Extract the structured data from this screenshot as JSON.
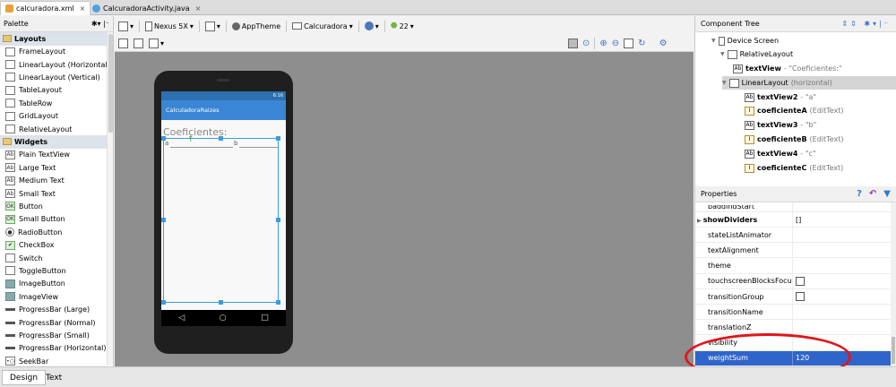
{
  "editor_tabs": [
    {
      "label": "calcuradora.xml",
      "close": "×",
      "icon": "xml-file-icon"
    },
    {
      "label": "CalcuradoraActivity.java",
      "close": "×",
      "icon": "java-class-icon"
    }
  ],
  "palette": {
    "title": "Palette",
    "tools": "✱▾ |⁻",
    "categories": [
      {
        "label": "Layouts",
        "items": [
          {
            "label": "FrameLayout",
            "icon": "layout-icon"
          },
          {
            "label": "LinearLayout (Horizontal)",
            "icon": "layout-icon"
          },
          {
            "label": "LinearLayout (Vertical)",
            "icon": "layout-icon"
          },
          {
            "label": "TableLayout",
            "icon": "layout-icon"
          },
          {
            "label": "TableRow",
            "icon": "layout-icon"
          },
          {
            "label": "GridLayout",
            "icon": "layout-icon"
          },
          {
            "label": "RelativeLayout",
            "icon": "layout-icon"
          }
        ]
      },
      {
        "label": "Widgets",
        "items": [
          {
            "label": "Plain TextView",
            "icon": "textview-icon",
            "glyph": "Ab"
          },
          {
            "label": "Large Text",
            "icon": "textview-icon",
            "glyph": "Ab"
          },
          {
            "label": "Medium Text",
            "icon": "textview-icon",
            "glyph": "Ab"
          },
          {
            "label": "Small Text",
            "icon": "textview-icon",
            "glyph": "Ab"
          },
          {
            "label": "Button",
            "icon": "button-icon",
            "glyph": "OK"
          },
          {
            "label": "Small Button",
            "icon": "button-icon",
            "glyph": "OK"
          },
          {
            "label": "RadioButton",
            "icon": "radio-button-icon",
            "glyph": "●"
          },
          {
            "label": "CheckBox",
            "icon": "checkbox-icon",
            "glyph": "✔"
          },
          {
            "label": "Switch",
            "icon": "switch-icon",
            "glyph": ""
          },
          {
            "label": "ToggleButton",
            "icon": "toggle-button-icon",
            "glyph": ""
          },
          {
            "label": "ImageButton",
            "icon": "image-button-icon",
            "glyph": ""
          },
          {
            "label": "ImageView",
            "icon": "image-view-icon",
            "glyph": ""
          },
          {
            "label": "ProgressBar (Large)",
            "icon": "progressbar-icon",
            "glyph": ""
          },
          {
            "label": "ProgressBar (Normal)",
            "icon": "progressbar-icon",
            "glyph": ""
          },
          {
            "label": "ProgressBar (Small)",
            "icon": "progressbar-icon",
            "glyph": ""
          },
          {
            "label": "ProgressBar (Horizontal)",
            "icon": "progressbar-icon",
            "glyph": ""
          },
          {
            "label": "SeekBar",
            "icon": "seekbar-icon",
            "glyph": "•○"
          }
        ]
      }
    ]
  },
  "toolbar": {
    "device": "Nexus 5X",
    "theme": "AppTheme",
    "activity": "Calcuradora",
    "api": "22",
    "dropdown": "▾"
  },
  "phone": {
    "status_time": "6:16",
    "app_title": "CalculadoraRaizes",
    "heading": "Coeficientes:",
    "field_a": "a",
    "field_b": "b",
    "nav": [
      "◁",
      "○",
      "□"
    ]
  },
  "component_tree": {
    "title": "Component Tree",
    "nodes": [
      {
        "label": "Device Screen",
        "hint": ""
      },
      {
        "label": "RelativeLayout",
        "hint": ""
      },
      {
        "label": "textView",
        "hint": " - \"Coeficientes:\""
      },
      {
        "label": "LinearLayout",
        "hint": " (horizontal)"
      },
      {
        "label": "textView2",
        "hint": " - \"a\""
      },
      {
        "label": "coeficienteA",
        "hint": " (EditText)"
      },
      {
        "label": "textView3",
        "hint": " - \"b\""
      },
      {
        "label": "coeficienteB",
        "hint": " (EditText)"
      },
      {
        "label": "textView4",
        "hint": " - \"c\""
      },
      {
        "label": "coeficienteC",
        "hint": " (EditText)"
      }
    ]
  },
  "properties": {
    "title": "Properties",
    "rows": [
      {
        "name": "paddingStart",
        "value": ""
      },
      {
        "name": "showDividers",
        "value": "[]"
      },
      {
        "name": "stateListAnimator",
        "value": ""
      },
      {
        "name": "textAlignment",
        "value": ""
      },
      {
        "name": "theme",
        "value": ""
      },
      {
        "name": "touchscreenBlocksFocus",
        "value": ""
      },
      {
        "name": "transitionGroup",
        "value": ""
      },
      {
        "name": "transitionName",
        "value": ""
      },
      {
        "name": "translationZ",
        "value": ""
      },
      {
        "name": "visibility",
        "value": ""
      },
      {
        "name": "weightSum",
        "value": "120"
      }
    ]
  },
  "bottom_tabs": [
    "Design",
    "Text"
  ],
  "colors": {
    "accent": "#2f65ca",
    "annotation": "#e0161c",
    "appbar": "#3a86d4",
    "selection": "#3c9bdc"
  }
}
